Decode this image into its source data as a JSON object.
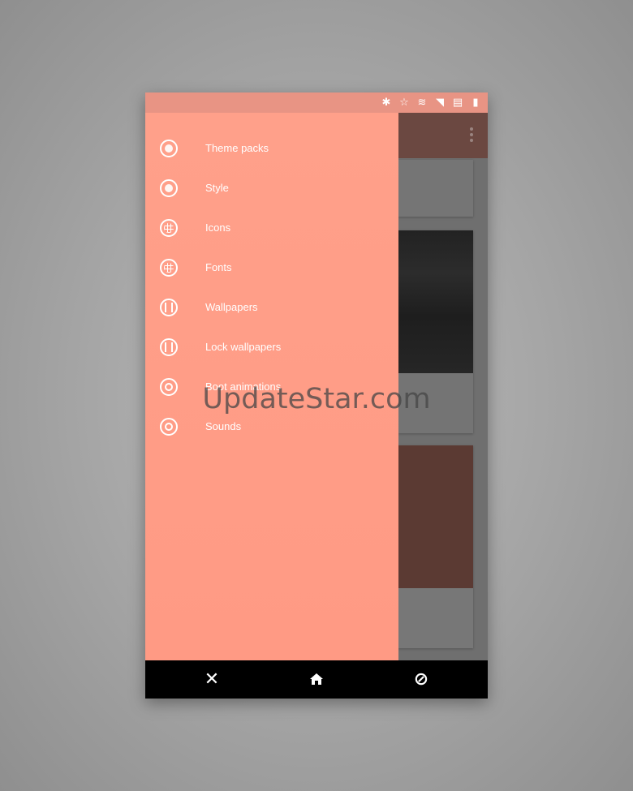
{
  "status_bar": {
    "icons": [
      "bluetooth-icon",
      "star-icon",
      "vibrate-icon",
      "signal-icon",
      "battery-saver-icon",
      "battery-icon"
    ],
    "glyphs": [
      "✱",
      "☆",
      "≋",
      "◥",
      "▤",
      "▮"
    ],
    "color": "#e89484"
  },
  "drawer": {
    "background": "#ff9d87",
    "items": [
      {
        "label": "Theme packs",
        "icon": "theme-packs-icon"
      },
      {
        "label": "Style",
        "icon": "style-icon"
      },
      {
        "label": "Icons",
        "icon": "icons-icon"
      },
      {
        "label": "Fonts",
        "icon": "fonts-icon"
      },
      {
        "label": "Wallpapers",
        "icon": "wallpapers-icon"
      },
      {
        "label": "Lock wallpapers",
        "icon": "lock-wallpapers-icon"
      },
      {
        "label": "Boot animations",
        "icon": "boot-animations-icon"
      },
      {
        "label": "Sounds",
        "icon": "sounds-icon"
      }
    ]
  },
  "nav_bar": {
    "close_glyph": "✕",
    "home_icon": "home-icon",
    "recents_glyph": "⊘"
  },
  "watermark": "UpdateStar.com"
}
